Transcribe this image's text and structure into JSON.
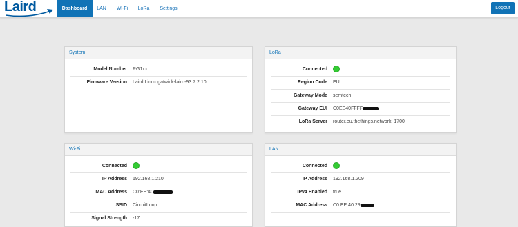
{
  "navbar": {
    "brand": "Laird",
    "items": [
      {
        "label": "Dashboard",
        "active": true
      },
      {
        "label": "LAN"
      },
      {
        "label": "Wi-Fi"
      },
      {
        "label": "LoRa"
      },
      {
        "label": "Settings"
      }
    ],
    "logout_label": "Logout"
  },
  "colors": {
    "accent": "#1173b6",
    "brand": "#005aa0",
    "status_connected": "#33cc33",
    "background": "#e9e9e9"
  },
  "system": {
    "title": "System",
    "model_number_label": "Model Number",
    "model_number": "RG1xx",
    "firmware_label": "Firmware Version",
    "firmware": "Laird Linux gatwick-laird-93.7.2.10"
  },
  "lora": {
    "title": "LoRa",
    "connected_label": "Connected",
    "connected": true,
    "region_label": "Region Code",
    "region": "EU",
    "gateway_mode_label": "Gateway Mode",
    "gateway_mode": "semtech",
    "gateway_eui_label": "Gateway EUI",
    "gateway_eui": "C0EE40FFFF",
    "server_label": "LoRa Server",
    "server": "router.eu.thethings.network: 1700"
  },
  "wifi": {
    "title": "Wi-Fi",
    "connected_label": "Connected",
    "connected": true,
    "ip_label": "IP Address",
    "ip": "192.168.1.210",
    "mac_label": "MAC Address",
    "mac": "C0:EE:40",
    "ssid_label": "SSID",
    "ssid": "CircuitLoop",
    "signal_label": "Signal Strength",
    "signal": "-17"
  },
  "lan": {
    "title": "LAN",
    "connected_label": "Connected",
    "connected": true,
    "ip_label": "IP Address",
    "ip": "192.168.1.209",
    "ipv4_label": "IPv4 Enabled",
    "ipv4": "true",
    "mac_label": "MAC Address",
    "mac": "C0:EE:40:29"
  }
}
